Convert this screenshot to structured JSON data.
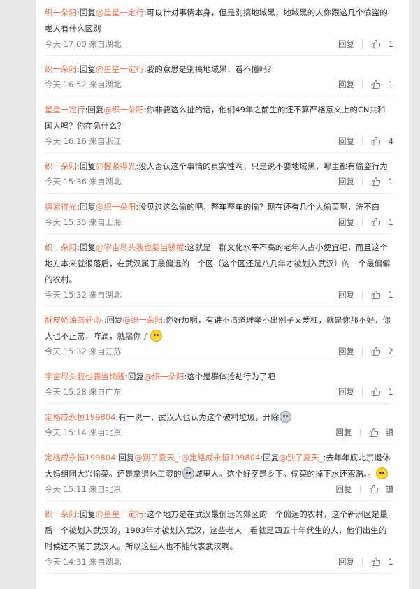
{
  "ui": {
    "reply_label": "回复",
    "reply_prefix": "回复",
    "mention": "@",
    "colon": ":"
  },
  "comments": [
    {
      "author": "织一朵阳",
      "reply_to": "星星一定行",
      "text": "可以针对事情本身，但是别搞地域黑，地域黑的人你跟这几个偷盗的老人有什么区别",
      "time": "今天 17:00",
      "location": "来自湖北",
      "likes": "1"
    },
    {
      "author": "织一朵阳",
      "reply_to": "星星一定行",
      "text": "我的意思是别搞地域黑，看不懂吗？",
      "time": "今天 16:52",
      "location": "来自湖北",
      "likes": "1"
    },
    {
      "author": "星星一定行",
      "reply_to": "织一朵阳",
      "text": "你非要这么扯的话，他们49年之前生的还不算严格意义上的CN共和国人吗？你在急什么？",
      "time": "今天 16:16",
      "location": "来自浙江",
      "likes": "4"
    },
    {
      "author": "织一朵阳",
      "reply_to": "握紧得光",
      "text": "没人否认这个事情的真实性啊，只是说不要地域黑，哪里都有偷盗行为",
      "time": "今天 15:36",
      "location": "来自湖北",
      "likes": "1"
    },
    {
      "author": "握紧得光",
      "reply_to": "织一朵阳",
      "text": "没见过这么偷的吧，整车整车的偷？现在还有几个人偷菜啊，洗不白",
      "time": "今天 15:35",
      "location": "来自上海",
      "likes": "1"
    },
    {
      "author": "织一朵阳",
      "reply_to": "宇宙尽头我也要当锈鲤",
      "text": "这就是一群文化水平不高的老年人占小便宜吧，而且这个地方本来就很落后，在武汉属于最偏远的一个区（这个区还是八几年才被划入武汉）的一个最偏僻的农村。",
      "time": "今天 15:32",
      "location": "来自湖北",
      "likes": "1"
    },
    {
      "author": "酥皮奶油蘑菇汤-",
      "reply_to": "织一朵阳",
      "text": "你好烦啊，有讲不清道理举不出例子又爱杠，就是你那不好，你人也不正常，咋滴，就黑你了",
      "emoji": "yellow",
      "time": "今天 15:32",
      "location": "来自江苏",
      "likes": "2"
    },
    {
      "author": "宇宙尽头我也要当锈鲤",
      "reply_to": "织一朵阳",
      "text": "这个是群体抢劫行为了吧",
      "time": "今天 15:28",
      "location": "来自广东",
      "likes": "1"
    },
    {
      "author": "定格成永恒199804",
      "text": "有一说一，武汉人也认为这个破村垃圾，开除",
      "emoji": "grey",
      "time": "今天 15:14",
      "location": "来自北京",
      "likes": "讃"
    },
    {
      "author": "定格成永恒199804",
      "reply_to": "别了夏天_",
      "mid_author": "定格成永恒199804",
      "mid_reply_to": "别了夏天_",
      "text_a": "去年年底北京退休大妈组团大兴偷菜。还是拿退休工资的",
      "text_b": "城里人。这个好歹是乡下。偷菜的掉下水还索赔。。",
      "time": "今天 15:11",
      "location": "来自北京",
      "likes": "讃"
    },
    {
      "author": "织一朵阳",
      "reply_to": "星星一定行",
      "text": "这个地方是在武汉最偏远的郊区的一个偏远的农村，这个新洲区是最后一个被划入武汉的，1983年才被划入武汉，这些老人一看就是四五十年代生的人，他们出生的时候还不属于武汉人。所以这些人也不能代表武汉啊。",
      "time": "今天 14:31",
      "location": "来自湖北",
      "likes": "1"
    }
  ]
}
